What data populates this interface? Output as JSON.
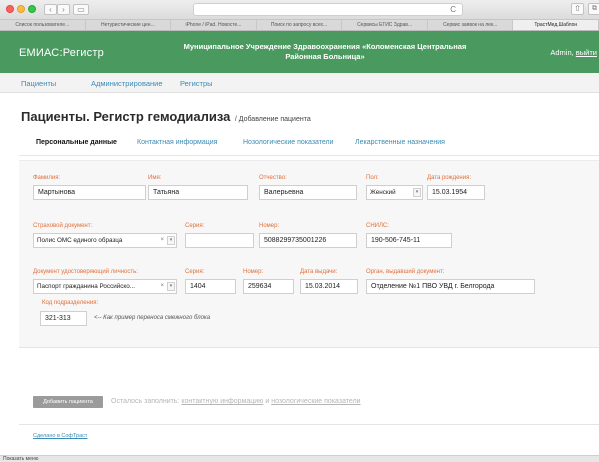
{
  "browser": {
    "bookmarks": [
      "Список пользователе...",
      "Нетуристические цен...",
      "iPhone / iPad. Новосте...",
      "Поиск по запросу всех...",
      "Сервисы ЕГИС Здрав...",
      "Сервис заявок на лек...",
      "ТрастМед.Шаблон"
    ],
    "reload_icon": "C",
    "status": "Показать меню"
  },
  "header": {
    "brand": "ЕМИАС:Регистр",
    "org_line1": "Муниципальное Учреждение Здравоохранения «Коломенская Центральная",
    "org_line2": "Районная Больница»",
    "user": "Admin,",
    "logout": "выйти"
  },
  "topnav": [
    "Пациенты",
    "Администрирование",
    "Регистры"
  ],
  "page": {
    "title": "Пациенты. Регистр гемодиализа",
    "subtitle": "/ Добавление пациента"
  },
  "tabs": [
    "Персональные данные",
    "Контактная информация",
    "Нозологические показатели",
    "Лекарственные назначения"
  ],
  "form": {
    "surname_label": "Фамилия:",
    "surname": "Мартынова",
    "name_label": "Имя:",
    "name": "Татьяна",
    "patronymic_label": "Отчество:",
    "patronymic": "Валерьевна",
    "sex_label": "Пол:",
    "sex": "Женский",
    "birth_label": "Дата рождения:",
    "birth": "15.03.1954",
    "ins_label": "Страховой документ:",
    "ins_type": "Полис ОМС единого образца",
    "ins_series_label": "Серия:",
    "ins_series": "",
    "ins_number_label": "Номер:",
    "ins_number": "5088299735001226",
    "snils_label": "СНИЛС:",
    "snils": "190-506-745-11",
    "id_label": "Документ удостоверяющий личность:",
    "id_type": "Паспорт гражданина Российско...",
    "id_series_label": "Серия:",
    "id_series": "1404",
    "id_number_label": "Номер:",
    "id_number": "259634",
    "id_date_label": "Дата выдачи:",
    "id_date": "15.03.2014",
    "id_org_label": "Орган, выдавший документ:",
    "id_org": "Отделение №1 ПВО УВД г. Белгорода",
    "subdiv_label": "Код подразделения:",
    "subdiv": "321-313",
    "note": "<-- Как пример переноса смежного блока",
    "clear_glyph": "×",
    "dropdown_glyph": "▾"
  },
  "bottom": {
    "add_button": "Добавить пациента",
    "remain_text": "Осталось заполнить:",
    "link1": "контактную информацию",
    "and": "и",
    "link2": "нозологические показатели"
  },
  "footer": {
    "link": "Сделано в СофТраст"
  }
}
